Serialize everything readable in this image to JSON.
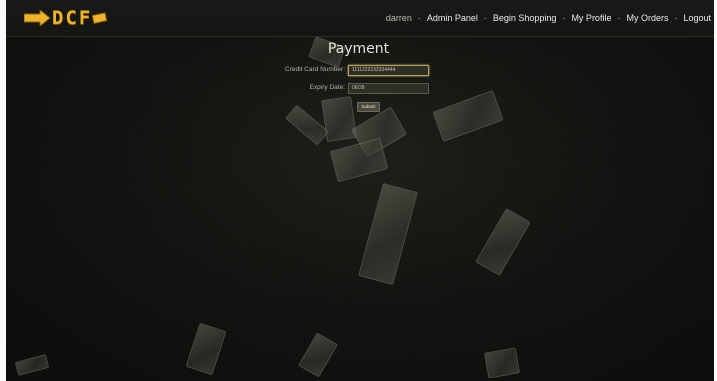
{
  "brand": {
    "logo_text": "DCF"
  },
  "nav": {
    "username": "darren",
    "separator": "-",
    "links": [
      "Admin Panel",
      "Begin Shopping",
      "My Profile",
      "My Orders",
      "Logout"
    ]
  },
  "page": {
    "title": "Payment",
    "fields": [
      {
        "label": "Credit Card Number:",
        "value": "1111222233334444"
      },
      {
        "label": "Expiry Date:",
        "value": "06/28"
      }
    ],
    "submit_label": "Submit"
  },
  "theme": {
    "accent": "#f0b429",
    "background": "#0c0c0b"
  },
  "background_image": "falling-money-icon"
}
